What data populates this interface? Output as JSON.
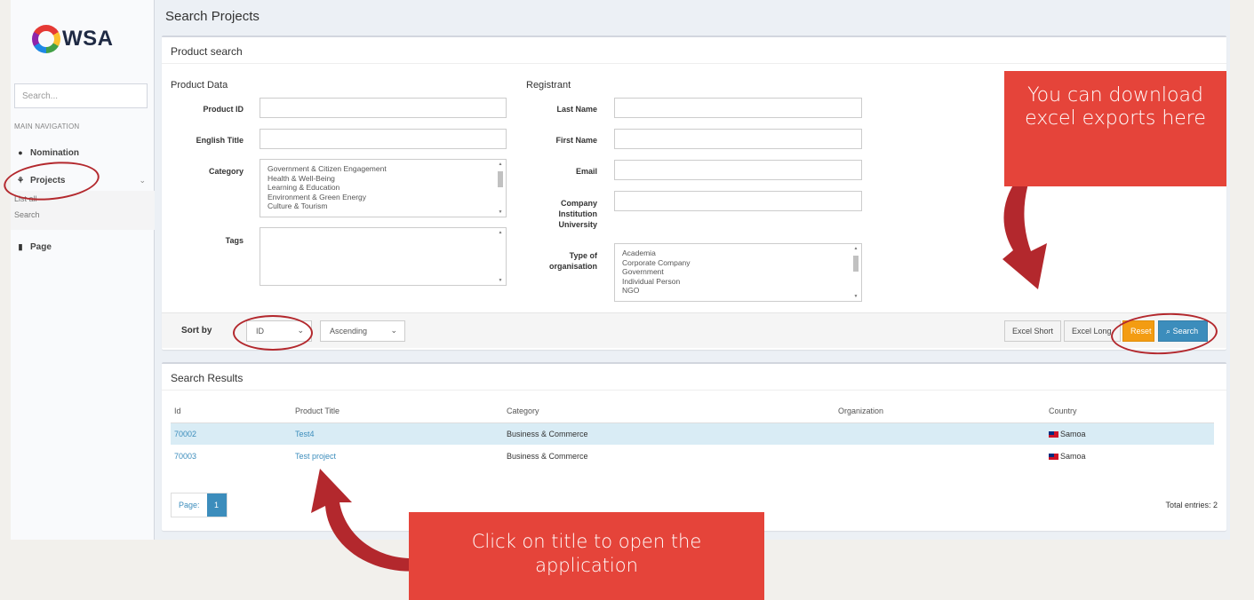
{
  "sidebar": {
    "logo_text": "WSA",
    "search_placeholder": "Search...",
    "nav_header": "MAIN NAVIGATION",
    "items": [
      {
        "label": "Nomination",
        "icon": "circle-icon"
      },
      {
        "label": "Projects",
        "icon": "sitemap-icon"
      },
      {
        "label": "Page",
        "icon": "file-icon"
      }
    ],
    "sub_items": [
      "List all",
      "Search"
    ]
  },
  "page_title": "Search Projects",
  "product_search": {
    "title": "Product search",
    "product_data_title": "Product Data",
    "registrant_title": "Registrant",
    "labels": {
      "product_id": "Product ID",
      "english_title": "English Title",
      "category": "Category",
      "tags": "Tags",
      "last_name": "Last Name",
      "first_name": "First Name",
      "email": "Email",
      "company": "Company Institution University",
      "type_of_org": "Type of organisation"
    },
    "categories": [
      "Government & Citizen Engagement",
      "Health & Well-Being",
      "Learning & Education",
      "Environment & Green Energy",
      "Culture & Tourism"
    ],
    "org_types": [
      "Academia",
      "Corporate Company",
      "Government",
      "Individual Person",
      "NGO"
    ]
  },
  "sortbar": {
    "sort_by_label": "Sort by",
    "sort_field": "ID",
    "sort_order": "Ascending",
    "excel_short": "Excel Short",
    "excel_long": "Excel Long",
    "reset": "Reset",
    "search": "Search"
  },
  "results": {
    "title": "Search Results",
    "columns": [
      "Id",
      "Product Title",
      "Category",
      "Organization",
      "Country"
    ],
    "rows": [
      {
        "id": "70002",
        "title": "Test4",
        "category": "Business & Commerce",
        "organization": "",
        "country": "Samoa"
      },
      {
        "id": "70003",
        "title": "Test project",
        "category": "Business & Commerce",
        "organization": "",
        "country": "Samoa"
      }
    ],
    "page_label": "Page:",
    "page_number": "1",
    "total": "Total entries: 2"
  },
  "callouts": {
    "excel": "You can download excel exports here",
    "title": "Click on title to open the application"
  },
  "colors": {
    "annotation_red": "#e5443a",
    "ring_red": "#b3282d",
    "primary_blue": "#3c8dbc",
    "reset_orange": "#f39c12"
  }
}
